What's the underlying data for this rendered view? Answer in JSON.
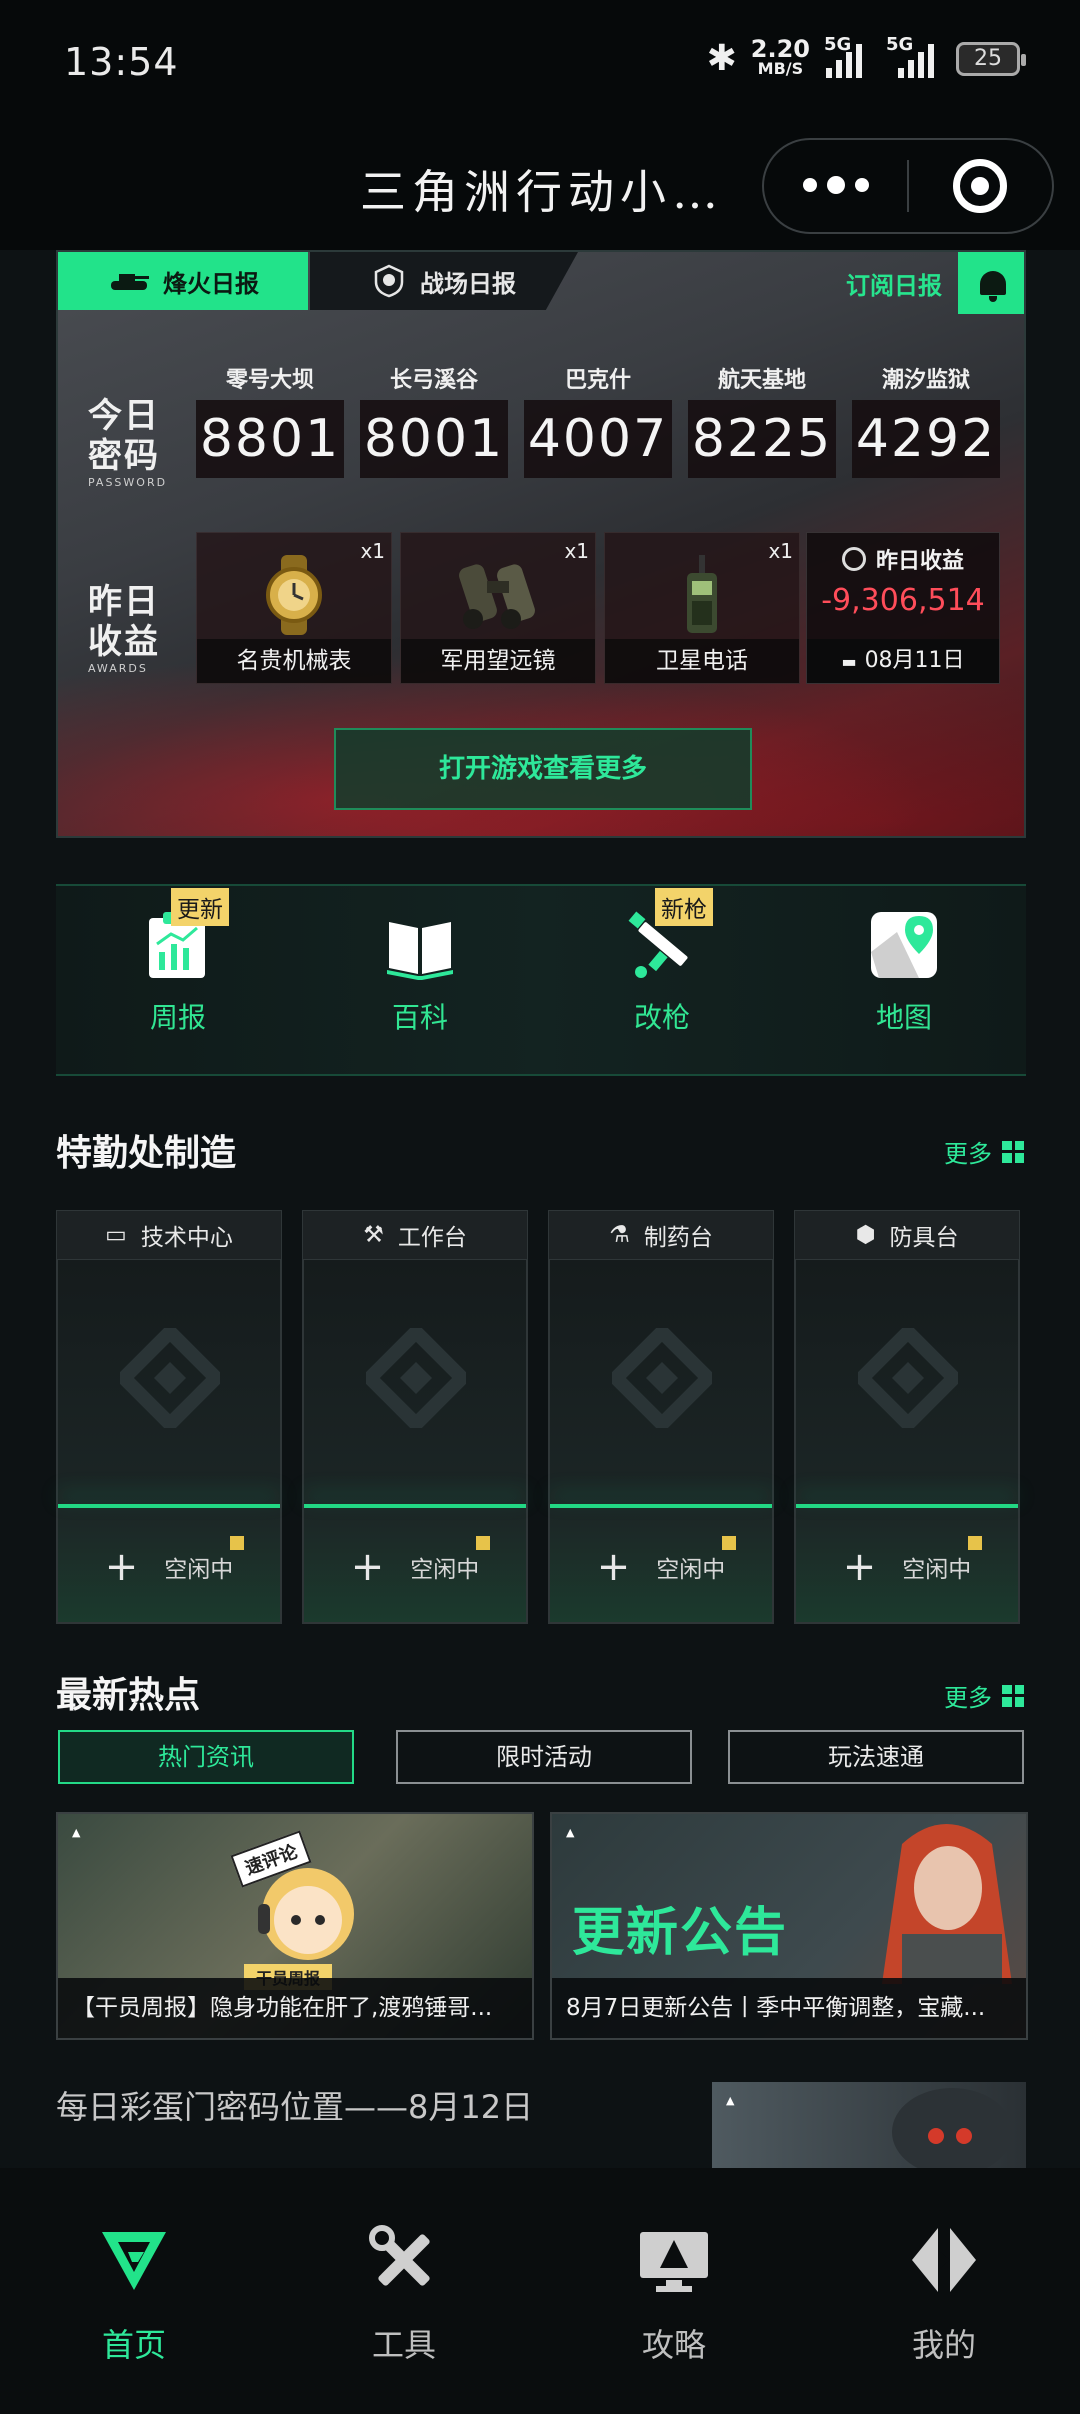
{
  "status_bar": {
    "time": "13:54",
    "net_speed": "2.20",
    "net_unit": "MB/S",
    "sim1": "5G",
    "sim2": "5G",
    "battery": "25"
  },
  "title_bar": {
    "title": "三角洲行动小…"
  },
  "report": {
    "tabs": [
      "烽火日报",
      "战场日报"
    ],
    "subscribe": "订阅日报",
    "today_label": "今日\n密码",
    "today_sub": "PASSWORD",
    "yesterday_label": "昨日\n收益",
    "yesterday_sub": "AWARDS",
    "maps": [
      {
        "name": "零号大坝",
        "code": "8801"
      },
      {
        "name": "长弓溪谷",
        "code": "8001"
      },
      {
        "name": "巴克什",
        "code": "4007"
      },
      {
        "name": "航天基地",
        "code": "8225"
      },
      {
        "name": "潮汐监狱",
        "code": "4292"
      }
    ],
    "rewards": [
      {
        "name": "名贵机械表",
        "qty": "x1"
      },
      {
        "name": "军用望远镜",
        "qty": "x1"
      },
      {
        "name": "卫星电话",
        "qty": "x1"
      }
    ],
    "earnings_title": "昨日收益",
    "earnings_value": "-9,306,514",
    "earnings_date": "08月11日",
    "open_game": "打开游戏查看更多"
  },
  "quick_tools": [
    {
      "label": "周报",
      "badge": "更新",
      "icon": "report-icon"
    },
    {
      "label": "百科",
      "badge": "",
      "icon": "book-icon"
    },
    {
      "label": "改枪",
      "badge": "新枪",
      "icon": "gun-icon"
    },
    {
      "label": "地图",
      "badge": "",
      "icon": "map-icon"
    }
  ],
  "crafting": {
    "title": "特勤处制造",
    "more": "更多",
    "stations": [
      {
        "name": "技术中心",
        "status": "空闲中"
      },
      {
        "name": "工作台",
        "status": "空闲中"
      },
      {
        "name": "制药台",
        "status": "空闲中"
      },
      {
        "name": "防具台",
        "status": "空闲中"
      }
    ]
  },
  "hotspot": {
    "title": "最新热点",
    "more": "更多",
    "tabs": [
      "热门资讯",
      "限时活动",
      "玩法速通"
    ],
    "news": [
      {
        "caption": "【干员周报】隐身功能在肝了,渡鸦锤哥..."
      },
      {
        "caption": "8月7日更新公告丨季中平衡调整，宝藏..."
      }
    ],
    "news_art_text": [
      "速评论",
      "干员周报",
      "更新公告"
    ],
    "daily_title": "每日彩蛋门密码位置——8月12日"
  },
  "bottom_nav": [
    {
      "label": "首页",
      "icon": "home-icon",
      "active": true
    },
    {
      "label": "工具",
      "icon": "tools-icon",
      "active": false
    },
    {
      "label": "攻略",
      "icon": "guide-icon",
      "active": false
    },
    {
      "label": "我的",
      "icon": "profile-icon",
      "active": false
    }
  ],
  "colors": {
    "accent": "#22e38a",
    "background": "#0d1214",
    "negative": "#ff4d5a",
    "badge": "#f3d36a"
  }
}
